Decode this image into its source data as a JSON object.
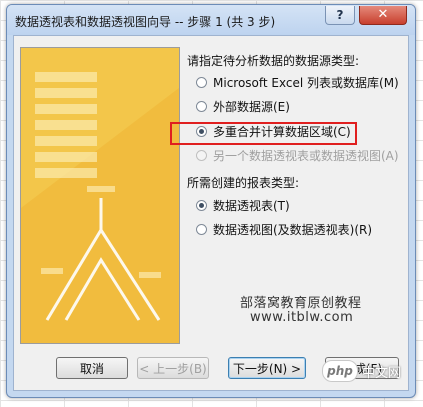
{
  "window": {
    "title": "数据透视表和数据透视图向导 -- 步骤 1 (共 3 步)",
    "help_glyph": "?",
    "close_glyph": "✕"
  },
  "source_group": {
    "label": "请指定待分析数据的数据源类型:",
    "options": [
      {
        "label": "Microsoft Excel 列表或数据库(M)",
        "checked": false,
        "enabled": true
      },
      {
        "label": "外部数据源(E)",
        "checked": false,
        "enabled": true
      },
      {
        "label": "多重合并计算数据区域(C)",
        "checked": true,
        "enabled": true
      },
      {
        "label": "另一个数据透视表或数据透视图(A)",
        "checked": false,
        "enabled": false
      }
    ]
  },
  "report_group": {
    "label": "所需创建的报表类型:",
    "options": [
      {
        "label": "数据透视表(T)",
        "checked": true,
        "enabled": true
      },
      {
        "label": "数据透视图(及数据透视表)(R)",
        "checked": false,
        "enabled": true
      }
    ]
  },
  "watermark": {
    "line1": "部落窝教育原创教程",
    "line2": "www.itblw.com"
  },
  "buttons": {
    "cancel": "取消",
    "back": "< 上一步(B)",
    "next": "下一步(N) >",
    "finish": "完成(F)"
  },
  "logo": {
    "badge": "php",
    "text": "中文网"
  },
  "colors": {
    "highlight": "#e01f1f",
    "illustration": "#f3c64a",
    "titlebar": "#c4d8f0"
  }
}
